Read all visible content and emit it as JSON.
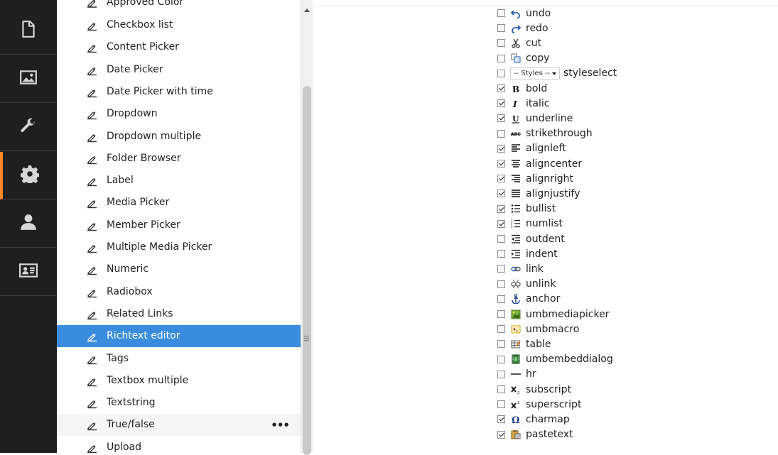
{
  "rail": {
    "items": [
      {
        "name": "content-section",
        "icon": "document-icon"
      },
      {
        "name": "media-section",
        "icon": "image-icon"
      },
      {
        "name": "developer-section",
        "icon": "wrench-icon"
      },
      {
        "name": "settings-section",
        "icon": "gear-icon",
        "active": true
      },
      {
        "name": "members-section",
        "icon": "user-icon"
      },
      {
        "name": "member-card-section",
        "icon": "id-card-icon"
      }
    ],
    "accent": "#f5862a"
  },
  "tree": {
    "partial_top_label": "Approved Color",
    "items": [
      {
        "label": "Checkbox list"
      },
      {
        "label": "Content Picker"
      },
      {
        "label": "Date Picker"
      },
      {
        "label": "Date Picker with time"
      },
      {
        "label": "Dropdown"
      },
      {
        "label": "Dropdown multiple"
      },
      {
        "label": "Folder Browser"
      },
      {
        "label": "Label"
      },
      {
        "label": "Media Picker"
      },
      {
        "label": "Member Picker"
      },
      {
        "label": "Multiple Media Picker"
      },
      {
        "label": "Numeric"
      },
      {
        "label": "Radiobox"
      },
      {
        "label": "Related Links"
      },
      {
        "label": "Richtext editor",
        "selected": true
      },
      {
        "label": "Tags"
      },
      {
        "label": "Textbox multiple"
      },
      {
        "label": "Textstring"
      },
      {
        "label": "True/false",
        "hover": true,
        "more": "•••"
      },
      {
        "label": "Upload"
      }
    ],
    "selected_color": "#3a8dde"
  },
  "toolbar": {
    "styles_placeholder": "-- Styles --",
    "items": [
      {
        "label": "undo",
        "checked": false,
        "icon": "undo-icon"
      },
      {
        "label": "redo",
        "checked": false,
        "icon": "redo-icon"
      },
      {
        "label": "cut",
        "checked": false,
        "icon": "scissors-icon"
      },
      {
        "label": "copy",
        "checked": false,
        "icon": "copy-icon"
      },
      {
        "label": "styleselect",
        "checked": false,
        "icon": "styles-select"
      },
      {
        "label": "bold",
        "checked": true,
        "icon": "bold-icon"
      },
      {
        "label": "italic",
        "checked": true,
        "icon": "italic-icon"
      },
      {
        "label": "underline",
        "checked": true,
        "icon": "underline-icon"
      },
      {
        "label": "strikethrough",
        "checked": false,
        "icon": "strikethrough-icon"
      },
      {
        "label": "alignleft",
        "checked": true,
        "icon": "align-left-icon"
      },
      {
        "label": "aligncenter",
        "checked": true,
        "icon": "align-center-icon"
      },
      {
        "label": "alignright",
        "checked": true,
        "icon": "align-right-icon"
      },
      {
        "label": "alignjustify",
        "checked": true,
        "icon": "align-justify-icon"
      },
      {
        "label": "bullist",
        "checked": true,
        "icon": "bullet-list-icon"
      },
      {
        "label": "numlist",
        "checked": true,
        "icon": "numbered-list-icon"
      },
      {
        "label": "outdent",
        "checked": false,
        "icon": "outdent-icon"
      },
      {
        "label": "indent",
        "checked": false,
        "icon": "indent-icon"
      },
      {
        "label": "link",
        "checked": false,
        "icon": "link-icon"
      },
      {
        "label": "unlink",
        "checked": false,
        "icon": "unlink-icon"
      },
      {
        "label": "anchor",
        "checked": false,
        "icon": "anchor-icon"
      },
      {
        "label": "umbmediapicker",
        "checked": false,
        "icon": "media-picker-icon"
      },
      {
        "label": "umbmacro",
        "checked": false,
        "icon": "macro-icon"
      },
      {
        "label": "table",
        "checked": false,
        "icon": "table-icon"
      },
      {
        "label": "umbembeddialog",
        "checked": false,
        "icon": "film-icon"
      },
      {
        "label": "hr",
        "checked": false,
        "icon": "horizontal-rule-icon"
      },
      {
        "label": "subscript",
        "checked": false,
        "icon": "subscript-icon"
      },
      {
        "label": "superscript",
        "checked": false,
        "icon": "superscript-icon"
      },
      {
        "label": "charmap",
        "checked": true,
        "icon": "omega-icon"
      },
      {
        "label": "pastetext",
        "checked": true,
        "icon": "paste-text-icon"
      }
    ]
  }
}
